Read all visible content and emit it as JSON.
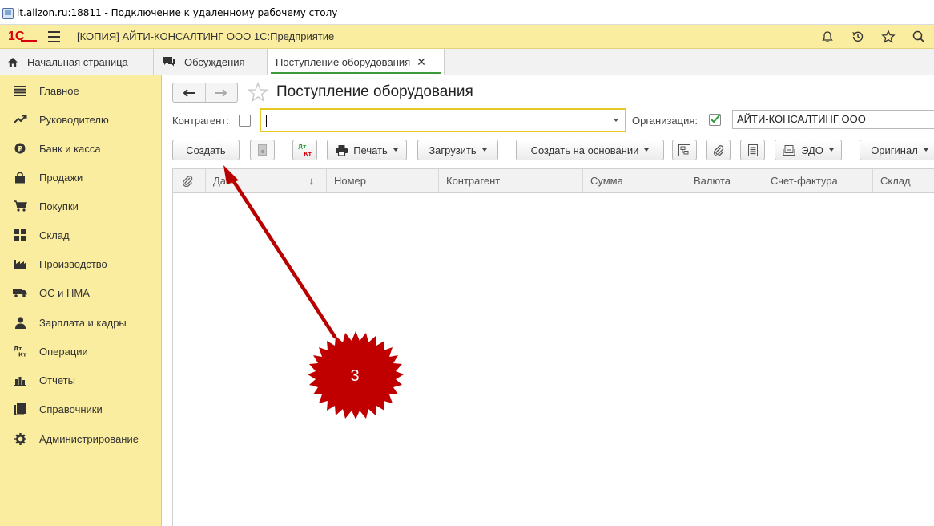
{
  "rdp": {
    "title": "it.allzon.ru:18811 - Подключение к удаленному рабочему столу"
  },
  "header": {
    "logo": "1С",
    "title": "[КОПИЯ] АЙТИ-КОНСАЛТИНГ ООО 1С:Предприятие",
    "icons": [
      "bell-icon",
      "history-icon",
      "star-icon",
      "search-icon"
    ]
  },
  "tabs": {
    "home": "Начальная страница",
    "discussions": "Обсуждения",
    "active": "Поступление оборудования"
  },
  "sidebar": {
    "items": [
      {
        "label": "Главное",
        "icon": "list-icon"
      },
      {
        "label": "Руководителю",
        "icon": "trend-icon"
      },
      {
        "label": "Банк и касса",
        "icon": "coin-icon"
      },
      {
        "label": "Продажи",
        "icon": "bag-icon"
      },
      {
        "label": "Покупки",
        "icon": "cart-icon"
      },
      {
        "label": "Склад",
        "icon": "warehouse-icon"
      },
      {
        "label": "Производство",
        "icon": "factory-icon"
      },
      {
        "label": "ОС и НМА",
        "icon": "truck-icon"
      },
      {
        "label": "Зарплата и кадры",
        "icon": "person-icon"
      },
      {
        "label": "Операции",
        "icon": "dt-kt-icon"
      },
      {
        "label": "Отчеты",
        "icon": "bar-chart-icon"
      },
      {
        "label": "Справочники",
        "icon": "book-icon"
      },
      {
        "label": "Администрирование",
        "icon": "gear-icon"
      }
    ]
  },
  "page": {
    "title": "Поступление оборудования"
  },
  "filters": {
    "kontragent_label": "Контрагент:",
    "kontragent_value": "",
    "organization_label": "Организация:",
    "organization_value": "АЙТИ-КОНСАЛТИНГ ООО"
  },
  "toolbar": {
    "create": "Создать",
    "dtkt_top": "Дт",
    "dtkt_bottom": "Кт",
    "print": "Печать",
    "load": "Загрузить",
    "create_based": "Создать на основании",
    "edo": "ЭДО",
    "original": "Оригинал"
  },
  "grid": {
    "columns": [
      "Дата",
      "Номер",
      "Контрагент",
      "Сумма",
      "Валюта",
      "Счет-фактура",
      "Склад"
    ],
    "sort_indicator": "↓",
    "rows": []
  },
  "annotation": {
    "step": "3",
    "color": "#c00000"
  }
}
